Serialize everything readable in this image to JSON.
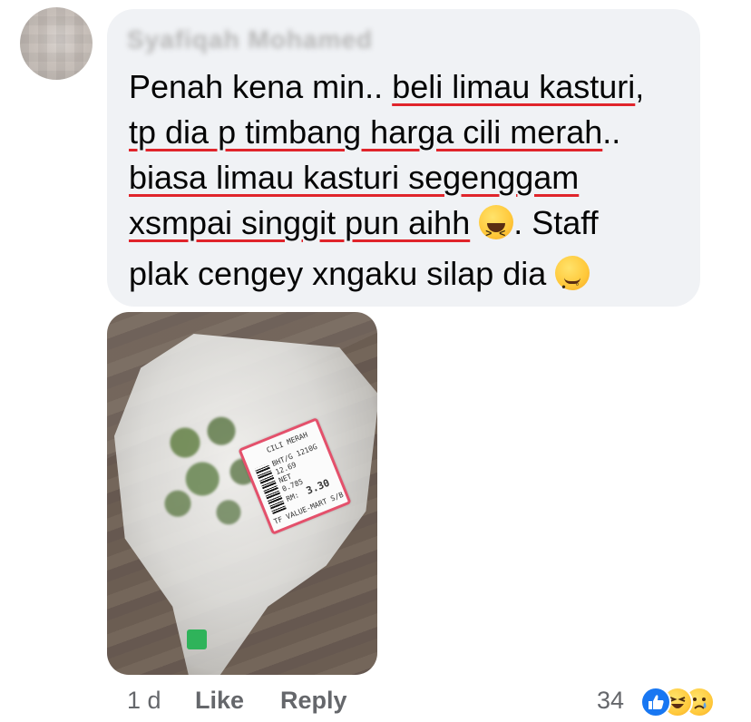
{
  "comment": {
    "author_name": "Syafiqah Mohamed",
    "lines": [
      [
        "Penah kena min.. ",
        "beli limau kasturi",
        ","
      ],
      [
        "",
        "tp dia p timbang harga cili merah",
        ".."
      ],
      [
        "",
        "biasa limau kasturi segenggam",
        ""
      ],
      [
        "",
        "xsmpai singgit pun aihh",
        ""
      ],
      [
        "plak cengey xngaku silap dia",
        "",
        ""
      ]
    ],
    "line4_after_emoji": ". Staff",
    "emojis": [
      "laughing-squint-emoji",
      "woozy-face-emoji"
    ]
  },
  "photo": {
    "label_lines": [
      "CILI MERAH",
      "BHT/G 1210G",
      "12.69",
      "NET",
      "0.785",
      "RM:",
      "3.30",
      "TF VALUE-MART S/B"
    ]
  },
  "footer": {
    "time": "1 d",
    "like_label": "Like",
    "reply_label": "Reply",
    "reaction_count": "34",
    "reactions": [
      "like-reaction-icon",
      "haha-reaction-icon",
      "sad-reaction-icon"
    ]
  },
  "colors": {
    "bubble_bg": "#f0f2f5",
    "underline": "#e0242b",
    "meta_text": "#65676b",
    "like_blue": "#1877f2"
  }
}
